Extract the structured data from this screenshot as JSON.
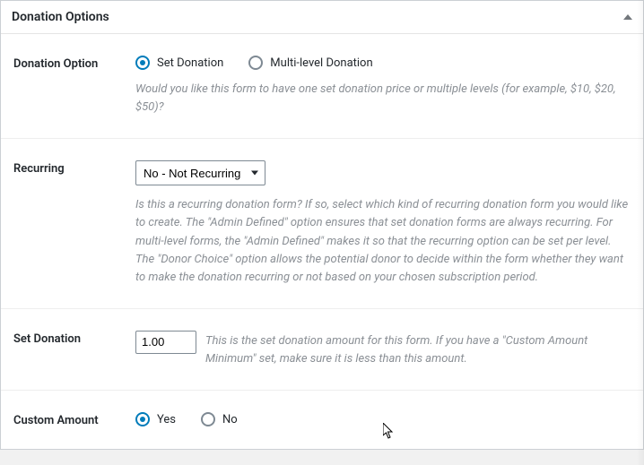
{
  "panel": {
    "title": "Donation Options"
  },
  "fields": {
    "donationOption": {
      "label": "Donation Option",
      "options": {
        "set": "Set Donation",
        "multi": "Multi-level Donation"
      },
      "help": "Would you like this form to have one set donation price or multiple levels (for example, $10, $20, $50)?"
    },
    "recurring": {
      "label": "Recurring",
      "selected": "No - Not Recurring",
      "help": "Is this a recurring donation form? If so, select which kind of recurring donation form you would like to create. The \"Admin Defined\" option ensures that set donation forms are always recurring. For multi-level forms, the \"Admin Defined\" makes it so that the recurring option can be set per level. The \"Donor Choice\" option allows the potential donor to decide within the form whether they want to make the donation recurring or not based on your chosen subscription period."
    },
    "setDonation": {
      "label": "Set Donation",
      "value": "1.00",
      "help": "This is the set donation amount for this form. If you have a \"Custom Amount Minimum\" set, make sure it is less than this amount."
    },
    "customAmount": {
      "label": "Custom Amount",
      "options": {
        "yes": "Yes",
        "no": "No"
      }
    }
  }
}
